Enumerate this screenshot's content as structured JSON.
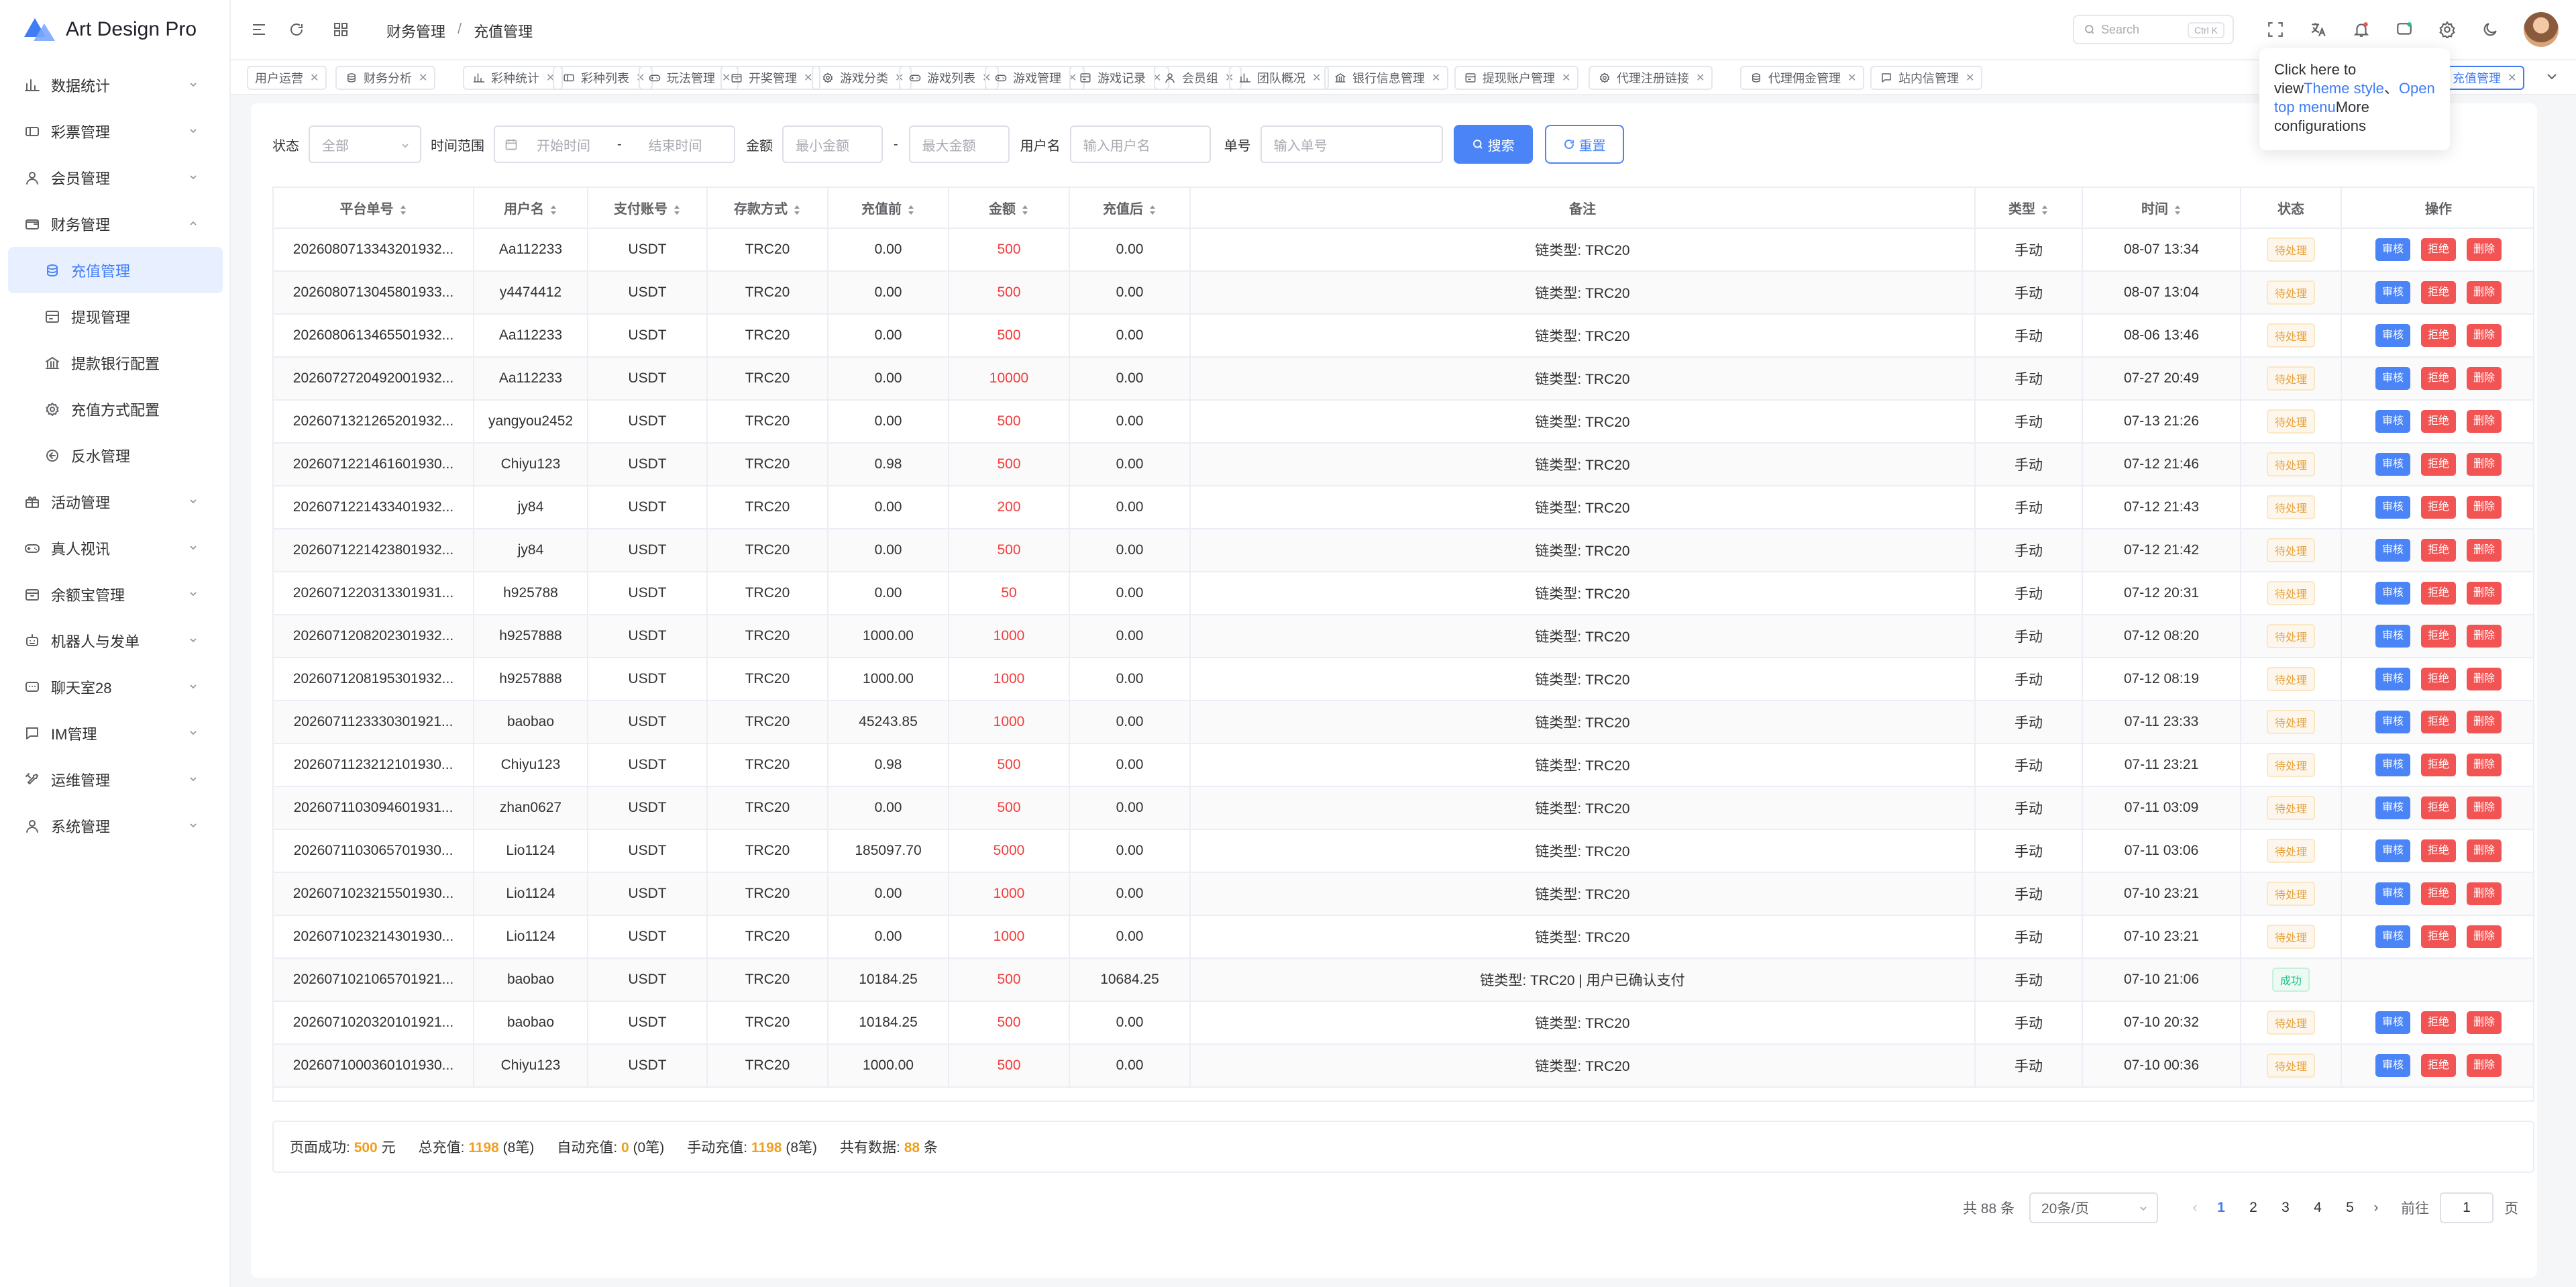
{
  "app": {
    "name": "Art Design Pro"
  },
  "sidebar": {
    "items": [
      {
        "label": "数据统计",
        "icon": "chart-icon"
      },
      {
        "label": "彩票管理",
        "icon": "ticket-icon"
      },
      {
        "label": "会员管理",
        "icon": "user-icon"
      },
      {
        "label": "财务管理",
        "icon": "wallet-icon",
        "expanded": true
      },
      {
        "label": "充值管理",
        "icon": "coins-icon",
        "sub": true,
        "active": true
      },
      {
        "label": "提现管理",
        "icon": "withdraw-icon",
        "sub": true
      },
      {
        "label": "提款银行配置",
        "icon": "bank-icon",
        "sub": true
      },
      {
        "label": "充值方式配置",
        "icon": "settings-icon",
        "sub": true
      },
      {
        "label": "反水管理",
        "icon": "rebate-icon",
        "sub": true
      },
      {
        "label": "活动管理",
        "icon": "gift-icon"
      },
      {
        "label": "真人视讯",
        "icon": "gamepad-icon"
      },
      {
        "label": "余额宝管理",
        "icon": "box-icon"
      },
      {
        "label": "机器人与发单",
        "icon": "robot-icon"
      },
      {
        "label": "聊天室28",
        "icon": "chat-icon"
      },
      {
        "label": "IM管理",
        "icon": "message-icon"
      },
      {
        "label": "运维管理",
        "icon": "tools-icon"
      },
      {
        "label": "系统管理",
        "icon": "user-icon"
      }
    ]
  },
  "header": {
    "breadcrumb": [
      "财务管理",
      "充值管理"
    ],
    "search_placeholder": "Search",
    "search_kbd": "Ctrl K"
  },
  "tabs": [
    "用户运营",
    "财务分析",
    "彩种统计",
    "彩种列表",
    "玩法管理",
    "开奖管理",
    "游戏分类",
    "游戏列表",
    "游戏管理",
    "游戏记录",
    "会员组",
    "团队概况",
    "银行信息管理",
    "提现账户管理",
    "代理注册链接",
    "代理佣金管理",
    "站内信管理",
    "充值管理"
  ],
  "tooltip": {
    "t1": "Click here to view",
    "l1": "Theme style",
    "t2": "、",
    "l2": "Open top menu",
    "t3": "More configurations"
  },
  "filter": {
    "status_label": "状态",
    "status_value": "全部",
    "time_label": "时间范围",
    "time_start": "开始时间",
    "time_sep": "-",
    "time_end": "结束时间",
    "amount_label": "金额",
    "min_amount": "最小金额",
    "amount_sep": "-",
    "max_amount": "最大金额",
    "username_label": "用户名",
    "username_placeholder": "输入用户名",
    "order_label": "单号",
    "order_placeholder": "输入单号",
    "search_button": "搜索",
    "reset_button": "重置"
  },
  "table": {
    "columns": [
      "平台单号",
      "用户名",
      "支付账号",
      "存款方式",
      "充值前",
      "金额",
      "充值后",
      "备注",
      "类型",
      "时间",
      "状态",
      "操作"
    ],
    "actions": {
      "approve": "审核",
      "reject": "拒绝",
      "delete": "删除"
    },
    "rows": [
      [
        "2026080713343201932...",
        "Aa112233",
        "USDT",
        "TRC20",
        "0.00",
        "500",
        "0.00",
        "链类型: TRC20",
        "手动",
        "08-07 13:34",
        "待处理"
      ],
      [
        "2026080713045801933...",
        "y4474412",
        "USDT",
        "TRC20",
        "0.00",
        "500",
        "0.00",
        "链类型: TRC20",
        "手动",
        "08-07 13:04",
        "待处理"
      ],
      [
        "2026080613465501932...",
        "Aa112233",
        "USDT",
        "TRC20",
        "0.00",
        "500",
        "0.00",
        "链类型: TRC20",
        "手动",
        "08-06 13:46",
        "待处理"
      ],
      [
        "2026072720492001932...",
        "Aa112233",
        "USDT",
        "TRC20",
        "0.00",
        "10000",
        "0.00",
        "链类型: TRC20",
        "手动",
        "07-27 20:49",
        "待处理"
      ],
      [
        "2026071321265201932...",
        "yangyou2452",
        "USDT",
        "TRC20",
        "0.00",
        "500",
        "0.00",
        "链类型: TRC20",
        "手动",
        "07-13 21:26",
        "待处理"
      ],
      [
        "2026071221461601930...",
        "Chiyu123",
        "USDT",
        "TRC20",
        "0.98",
        "500",
        "0.00",
        "链类型: TRC20",
        "手动",
        "07-12 21:46",
        "待处理"
      ],
      [
        "2026071221433401932...",
        "jy84",
        "USDT",
        "TRC20",
        "0.00",
        "200",
        "0.00",
        "链类型: TRC20",
        "手动",
        "07-12 21:43",
        "待处理"
      ],
      [
        "2026071221423801932...",
        "jy84",
        "USDT",
        "TRC20",
        "0.00",
        "500",
        "0.00",
        "链类型: TRC20",
        "手动",
        "07-12 21:42",
        "待处理"
      ],
      [
        "2026071220313301931...",
        "h925788",
        "USDT",
        "TRC20",
        "0.00",
        "50",
        "0.00",
        "链类型: TRC20",
        "手动",
        "07-12 20:31",
        "待处理"
      ],
      [
        "2026071208202301932...",
        "h9257888",
        "USDT",
        "TRC20",
        "1000.00",
        "1000",
        "0.00",
        "链类型: TRC20",
        "手动",
        "07-12 08:20",
        "待处理"
      ],
      [
        "2026071208195301932...",
        "h9257888",
        "USDT",
        "TRC20",
        "1000.00",
        "1000",
        "0.00",
        "链类型: TRC20",
        "手动",
        "07-12 08:19",
        "待处理"
      ],
      [
        "2026071123330301921...",
        "baobao",
        "USDT",
        "TRC20",
        "45243.85",
        "1000",
        "0.00",
        "链类型: TRC20",
        "手动",
        "07-11 23:33",
        "待处理"
      ],
      [
        "2026071123212101930...",
        "Chiyu123",
        "USDT",
        "TRC20",
        "0.98",
        "500",
        "0.00",
        "链类型: TRC20",
        "手动",
        "07-11 23:21",
        "待处理"
      ],
      [
        "2026071103094601931...",
        "zhan0627",
        "USDT",
        "TRC20",
        "0.00",
        "500",
        "0.00",
        "链类型: TRC20",
        "手动",
        "07-11 03:09",
        "待处理"
      ],
      [
        "2026071103065701930...",
        "Lio1124",
        "USDT",
        "TRC20",
        "185097.70",
        "5000",
        "0.00",
        "链类型: TRC20",
        "手动",
        "07-11 03:06",
        "待处理"
      ],
      [
        "2026071023215501930...",
        "Lio1124",
        "USDT",
        "TRC20",
        "0.00",
        "1000",
        "0.00",
        "链类型: TRC20",
        "手动",
        "07-10 23:21",
        "待处理"
      ],
      [
        "2026071023214301930...",
        "Lio1124",
        "USDT",
        "TRC20",
        "0.00",
        "1000",
        "0.00",
        "链类型: TRC20",
        "手动",
        "07-10 23:21",
        "待处理"
      ],
      [
        "2026071021065701921...",
        "baobao",
        "USDT",
        "TRC20",
        "10184.25",
        "500",
        "10684.25",
        "链类型: TRC20 | 用户已确认支付",
        "手动",
        "07-10 21:06",
        "成功"
      ],
      [
        "2026071020320101921...",
        "baobao",
        "USDT",
        "TRC20",
        "10184.25",
        "500",
        "0.00",
        "链类型: TRC20",
        "手动",
        "07-10 20:32",
        "待处理"
      ],
      [
        "2026071000360101930...",
        "Chiyu123",
        "USDT",
        "TRC20",
        "1000.00",
        "500",
        "0.00",
        "链类型: TRC20",
        "手动",
        "07-10 00:36",
        "待处理"
      ]
    ]
  },
  "summary": {
    "page_label": "页面成功:",
    "page_value": "500",
    "page_unit": "元",
    "total_label": "总充值:",
    "total_value": "1198",
    "total_count": "(8笔)",
    "auto_label": "自动充值:",
    "auto_value": "0",
    "auto_count": "(0笔)",
    "manual_label": "手动充值:",
    "manual_value": "1198",
    "manual_count": "(8笔)",
    "all_label": "共有数据:",
    "all_value": "88",
    "all_unit": "条"
  },
  "pagination": {
    "total": "共 88 条",
    "page_size": "20条/页",
    "pages": [
      "1",
      "2",
      "3",
      "4",
      "5"
    ],
    "current": "1",
    "goto_label": "前往",
    "goto_value": "1",
    "goto_unit": "页"
  },
  "colors": {
    "primary": "#4a84f6",
    "danger": "#f25454",
    "amount": "#f23c3c",
    "warning": "#e6a23c",
    "success": "#20c08b",
    "highlight": "#f0a020"
  }
}
